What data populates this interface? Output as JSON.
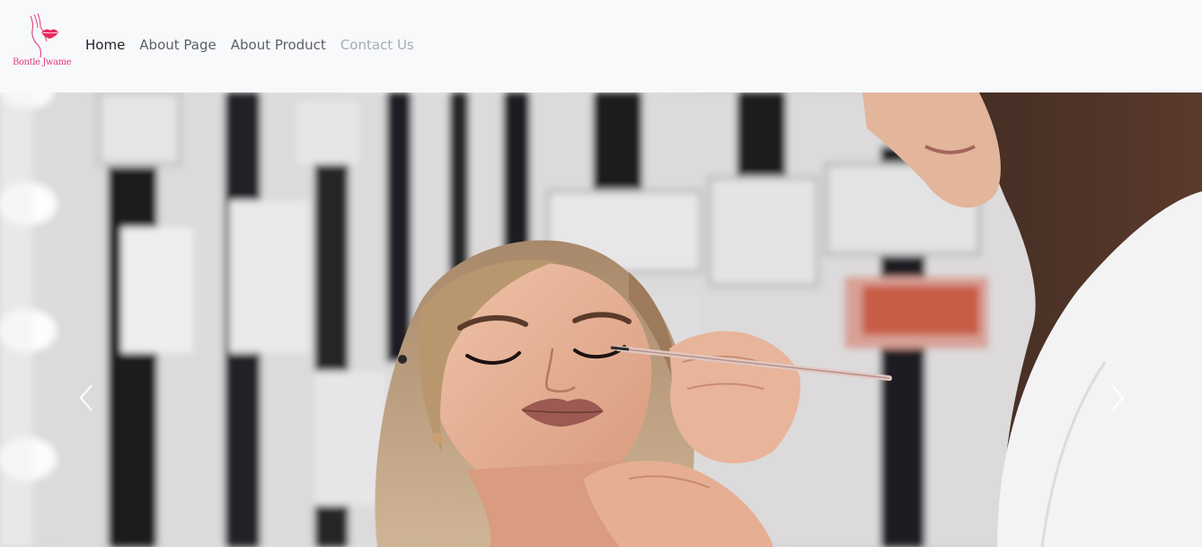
{
  "brand": {
    "name": "Bontle Jwame",
    "logo_icon": "lips-hand-logo-icon",
    "color": "#e23c79"
  },
  "nav": {
    "items": [
      {
        "label": "Home",
        "state": "active"
      },
      {
        "label": "About Page",
        "state": "default"
      },
      {
        "label": "About Product",
        "state": "default"
      },
      {
        "label": "Contact Us",
        "state": "muted"
      }
    ]
  },
  "carousel": {
    "slide_description_icon": "makeup-application-photo",
    "prev_icon": "chevron-left-icon",
    "next_icon": "chevron-right-icon"
  }
}
